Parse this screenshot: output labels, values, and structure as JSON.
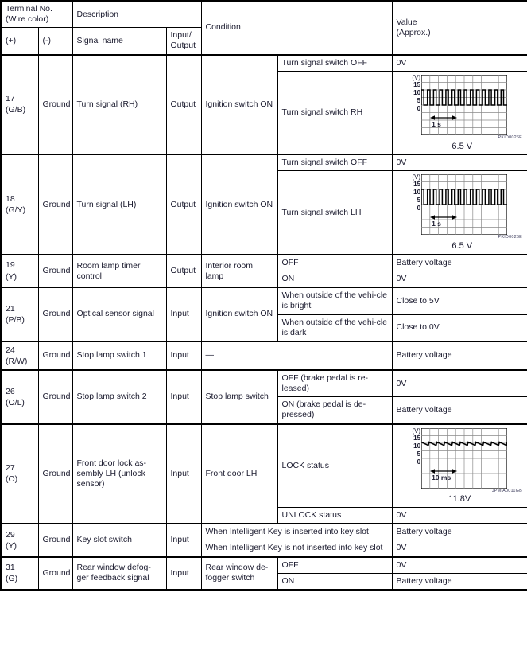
{
  "table": {
    "headers": {
      "terminal_no": "Terminal No.",
      "wire_color": "(Wire color)",
      "plus": "(+)",
      "minus": "(-)",
      "description": "Description",
      "signal_name": "Signal name",
      "input_output_line1": "Input/",
      "input_output_line2": "Output",
      "condition": "Condition",
      "value_line1": "Value",
      "value_line2": "(Approx.)"
    },
    "rows": [
      {
        "terminal": "17",
        "wire": "(G/B)",
        "ground": "Ground",
        "signal": "Turn signal (RH)",
        "io": "Output",
        "condition_main": "Ignition switch ON",
        "subrows": [
          {
            "condition": "Turn signal switch OFF",
            "value": "0V"
          },
          {
            "condition": "Turn signal switch RH",
            "value_type": "waveform",
            "waveform": "turn_signal_rh"
          }
        ]
      },
      {
        "terminal": "18",
        "wire": "(G/Y)",
        "ground": "Ground",
        "signal": "Turn signal (LH)",
        "io": "Output",
        "condition_main": "Ignition switch ON",
        "subrows": [
          {
            "condition": "Turn signal switch OFF",
            "value": "0V"
          },
          {
            "condition": "Turn signal switch LH",
            "value_type": "waveform",
            "waveform": "turn_signal_lh"
          }
        ]
      },
      {
        "terminal": "19",
        "wire": "(Y)",
        "ground": "Ground",
        "signal": "Room lamp timer control",
        "io": "Output",
        "condition_main": "Interior room lamp",
        "subrows": [
          {
            "condition": "OFF",
            "value": "Battery voltage"
          },
          {
            "condition": "ON",
            "value": "0V"
          }
        ]
      },
      {
        "terminal": "21",
        "wire": "(P/B)",
        "ground": "Ground",
        "signal": "Optical sensor signal",
        "io": "Input",
        "condition_main": "Ignition switch ON",
        "subrows": [
          {
            "condition": "When outside of the vehi-cle is bright",
            "value": "Close to 5V"
          },
          {
            "condition": "When outside of the vehi-cle is dark",
            "value": "Close to 0V"
          }
        ]
      },
      {
        "terminal": "24",
        "wire": "(R/W)",
        "ground": "Ground",
        "signal": "Stop lamp switch 1",
        "io": "Input",
        "condition_span": "—",
        "subrows": [
          {
            "value": "Battery voltage"
          }
        ]
      },
      {
        "terminal": "26",
        "wire": "(O/L)",
        "ground": "Ground",
        "signal": "Stop lamp switch 2",
        "io": "Input",
        "condition_main": "Stop lamp switch",
        "subrows": [
          {
            "condition": "OFF (brake pedal is re-leased)",
            "value": "0V"
          },
          {
            "condition": "ON (brake pedal is de-pressed)",
            "value": "Battery voltage"
          }
        ]
      },
      {
        "terminal": "27",
        "wire": "(O)",
        "ground": "Ground",
        "signal": "Front door lock as-sembly LH (unlock sensor)",
        "io": "Input",
        "condition_main": "Front door LH",
        "subrows": [
          {
            "condition": "LOCK status",
            "value_type": "waveform",
            "waveform": "door_lock_lh"
          },
          {
            "condition": "UNLOCK status",
            "value": "0V"
          }
        ]
      },
      {
        "terminal": "29",
        "wire": "(Y)",
        "ground": "Ground",
        "signal": "Key slot switch",
        "io": "Input",
        "subrows": [
          {
            "condition_wide": "When Intelligent Key is inserted into key slot",
            "value": "Battery voltage"
          },
          {
            "condition_wide": "When Intelligent Key is not inserted into key slot",
            "value": "0V"
          }
        ]
      },
      {
        "terminal": "31",
        "wire": "(G)",
        "ground": "Ground",
        "signal": "Rear window defog-ger feedback signal",
        "io": "Input",
        "condition_main": "Rear window de-fogger switch",
        "subrows": [
          {
            "condition": "OFF",
            "value": "0V"
          },
          {
            "condition": "ON",
            "value": "Battery voltage"
          }
        ]
      }
    ]
  },
  "waveforms": {
    "turn_signal_rh": {
      "unit": "(V)",
      "y_ticks": [
        "15",
        "10",
        "5",
        "0"
      ],
      "time_label": "1 s",
      "code": "PKID0026E",
      "value_label": "6.5 V",
      "shape": "pulse-train"
    },
    "turn_signal_lh": {
      "unit": "(V)",
      "y_ticks": [
        "15",
        "10",
        "5",
        "0"
      ],
      "time_label": "1 s",
      "code": "PKID0026E",
      "value_label": "6.5 V",
      "shape": "pulse-train"
    },
    "door_lock_lh": {
      "unit": "(V)",
      "y_ticks": [
        "15",
        "10",
        "5",
        "0"
      ],
      "time_label": "10 ms",
      "code": "JPMIA0011GB",
      "value_label": "11.8V",
      "shape": "sawtooth-ripple"
    }
  },
  "chart_data": [
    {
      "type": "line",
      "name": "turn_signal_rh",
      "title": "Turn signal (RH) waveform",
      "ylabel": "(V)",
      "ytick_values": [
        15,
        10,
        5,
        0
      ],
      "ylim": [
        -5,
        20
      ],
      "xlabel": "1 s",
      "grid": true,
      "description": "Square pulse train, high level approx 12V, low level 0V, about 14 narrow pulses across screen",
      "high_level": 12,
      "low_level": 0,
      "pulse_count": 14,
      "average_value": 6.5
    },
    {
      "type": "line",
      "name": "turn_signal_lh",
      "title": "Turn signal (LH) waveform",
      "ylabel": "(V)",
      "ytick_values": [
        15,
        10,
        5,
        0
      ],
      "ylim": [
        -5,
        20
      ],
      "xlabel": "1 s",
      "grid": true,
      "description": "Square pulse train, high level approx 12V, low level 0V, about 14 narrow pulses across screen",
      "high_level": 12,
      "low_level": 0,
      "pulse_count": 14,
      "average_value": 6.5
    },
    {
      "type": "line",
      "name": "door_lock_lh",
      "title": "Front door lock assembly LH (unlock sensor) LOCK status waveform",
      "ylabel": "(V)",
      "ytick_values": [
        15,
        10,
        5,
        0
      ],
      "ylim": [
        -5,
        20
      ],
      "xlabel": "10 ms",
      "grid": true,
      "description": "Nearly flat sawtooth ripple slightly above 10V with small downward teeth",
      "nominal_level": 11.8,
      "ripple_amplitude": 0.8,
      "average_value": 11.8
    }
  ]
}
